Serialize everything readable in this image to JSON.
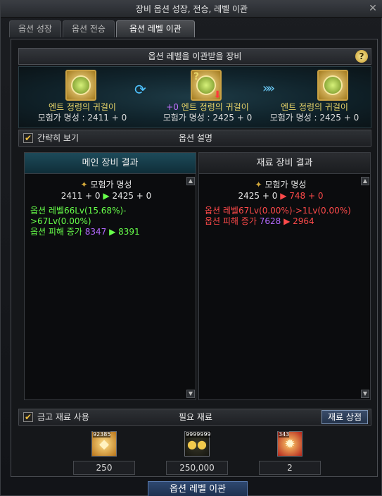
{
  "window": {
    "title": "장비 옵션 성장, 전승, 레벨 이관"
  },
  "tabs": [
    {
      "label": "옵션 성장",
      "active": false
    },
    {
      "label": "옵션 전승",
      "active": false
    },
    {
      "label": "옵션 레벨 이관",
      "active": true
    }
  ],
  "header": {
    "title": "옵션 레벨을 이관받을 장비",
    "help_icon": "?"
  },
  "equipment": {
    "left": {
      "name": "엔트 정령의 귀걸이",
      "stat": "모험가 명성 : 2411 + 0"
    },
    "center": {
      "plus": "+0",
      "name": "엔트 정령의 귀걸이",
      "stat": "모험가 명성 : 2425 + 0"
    },
    "right": {
      "name": "엔트 정령의 귀걸이",
      "stat": "모험가 명성 : 2425 + 0"
    }
  },
  "simple_view": {
    "label": "간략히 보기",
    "checked": true
  },
  "option_desc_title": "옵션 설명",
  "main_result": {
    "title": "메인 장비 결과",
    "stat_title": "모험가 명성",
    "stat_from": "2411 + 0",
    "stat_to": "2425 + 0",
    "opt_line1": "옵션 레벨66Lv(15.68%)->67Lv(0.00%)",
    "opt_line2_label": "옵션 피해 증가",
    "opt_line2_from": "8347",
    "opt_line2_to": "8391"
  },
  "material_result": {
    "title": "재료 장비 결과",
    "stat_title": "모험가 명성",
    "stat_from": "2425 + 0",
    "stat_to": "748 + 0",
    "opt_line1": "옵션 레벨67Lv(0.00%)->1Lv(0.00%)",
    "opt_line2_label": "옵션 피해 증가",
    "opt_line2_from": "7628",
    "opt_line2_to": "2964"
  },
  "materials_bar": {
    "use_storage_label": "금고 재료 사용",
    "checked": true,
    "title": "필요 재료",
    "shop_label": "재료 상점"
  },
  "materials": [
    {
      "icon": "gem-pouch-icon",
      "count_badge": "92385",
      "value": "250"
    },
    {
      "icon": "gold-coins-icon",
      "count_badge": "9999999",
      "value": "250,000"
    },
    {
      "icon": "spark-orb-icon",
      "count_badge": "343",
      "value": "2"
    }
  ],
  "action": {
    "label": "옵션 레벨 이관"
  },
  "colors": {
    "accent_green": "#67ff4a",
    "accent_red": "#ff4a4a",
    "accent_purple": "#b46aff",
    "header_gold": "#e8d56a"
  }
}
